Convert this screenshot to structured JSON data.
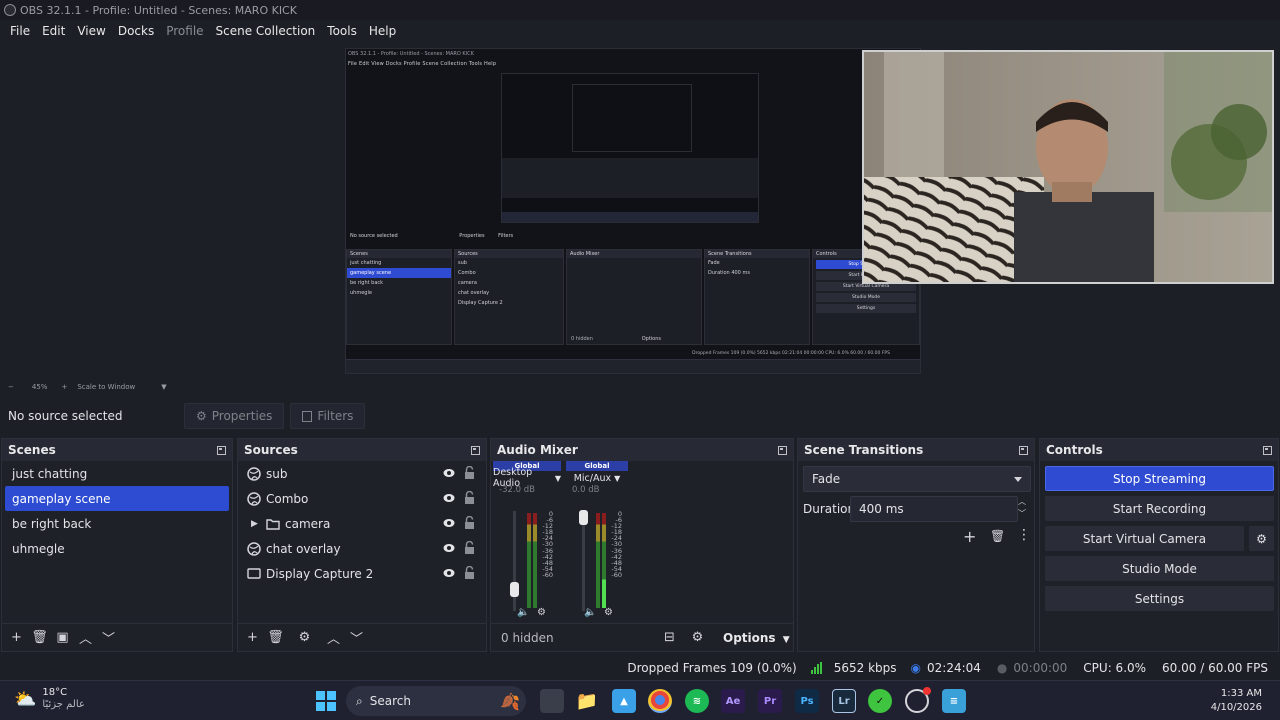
{
  "window": {
    "title": "OBS 32.1.1 - Profile: Untitled - Scenes: MARO KICK"
  },
  "menu": [
    "File",
    "Edit",
    "View",
    "Docks",
    "Profile",
    "Scene Collection",
    "Tools",
    "Help"
  ],
  "preview": {
    "zoom": "45%",
    "scale_label": "Scale to Window"
  },
  "nested_preview": {
    "title": "OBS 32.1.1 - Profile: Untitled - Scenes: MARO KICK",
    "menu": "File   Edit   View   Docks   Profile   Scene Collection   Tools   Help",
    "no_source": "No source selected",
    "properties": "Properties",
    "filters": "Filters",
    "scenes_head": "Scenes",
    "sources_head": "Sources",
    "mixer_head": "Audio Mixer",
    "transitions_head": "Scene Transitions",
    "controls_head": "Controls",
    "scenes": [
      "just chatting",
      "gameplay scene",
      "be right back",
      "uhmegle"
    ],
    "sources": [
      "sub",
      "Combo",
      "camera",
      "chat overlay",
      "Display Capture 2"
    ],
    "transition": "Fade",
    "duration_label": "Duration",
    "duration": "400 ms",
    "controls": [
      "Stop Streaming",
      "Start Recording",
      "Start Virtual Camera",
      "Studio Mode",
      "Settings"
    ],
    "status": "Dropped Frames 109 (0.0%)   5652 kbps   02:21:04   00:00:00   CPU: 6.0%   60.00 / 60.00 FPS",
    "hidden": "0 hidden",
    "options": "Options"
  },
  "source_bar": {
    "status": "No source selected",
    "properties": "Properties",
    "filters": "Filters"
  },
  "scenes": {
    "title": "Scenes",
    "items": [
      "just chatting",
      "gameplay scene",
      "be right back",
      "uhmegle"
    ],
    "selected": "gameplay scene"
  },
  "sources": {
    "title": "Sources",
    "items": [
      {
        "name": "sub",
        "icon": "globe-icon"
      },
      {
        "name": "Combo",
        "icon": "globe-icon"
      },
      {
        "name": "camera",
        "icon": "folder-icon"
      },
      {
        "name": "chat overlay",
        "icon": "globe-icon"
      },
      {
        "name": "Display Capture 2",
        "icon": "monitor-icon"
      }
    ]
  },
  "mixer": {
    "title": "Audio Mixer",
    "channels": [
      {
        "badge": "Global",
        "name": "Desktop Audio",
        "db": "-32.0 dB",
        "fader_level": 0.3
      },
      {
        "badge": "Global",
        "name": "Mic/Aux",
        "db": "0.0 dB",
        "fader_level": 1.0
      }
    ],
    "scale": [
      "0",
      "-6",
      "-12",
      "-18",
      "-24",
      "-30",
      "-36",
      "-42",
      "-48",
      "-54",
      "-60"
    ],
    "hidden": "0 hidden",
    "options": "Options"
  },
  "transitions": {
    "title": "Scene Transitions",
    "selected": "Fade",
    "duration_label": "Duration",
    "duration": "400 ms"
  },
  "controls": {
    "title": "Controls",
    "stop_streaming": "Stop Streaming",
    "start_recording": "Start Recording",
    "start_virtual_camera": "Start Virtual Camera",
    "studio_mode": "Studio Mode",
    "settings": "Settings"
  },
  "status": {
    "dropped_frames": "Dropped Frames 109 (0.0%)",
    "bitrate": "5652 kbps",
    "stream_time": "02:24:04",
    "record_time": "00:00:00",
    "cpu": "CPU: 6.0%",
    "fps": "60.00 / 60.00 FPS",
    "colors": {
      "ok": "#3ec43e",
      "live": "#3a7be8"
    }
  },
  "taskbar": {
    "weather_temp": "18°C",
    "weather_place": "عالم جزئيًا",
    "search": "Search",
    "time": "1:33 AM",
    "date": "4/10/2026"
  },
  "colors": {
    "accent": "#2e4bd2",
    "background": "#1d1f26",
    "panel": "#1f2129"
  }
}
